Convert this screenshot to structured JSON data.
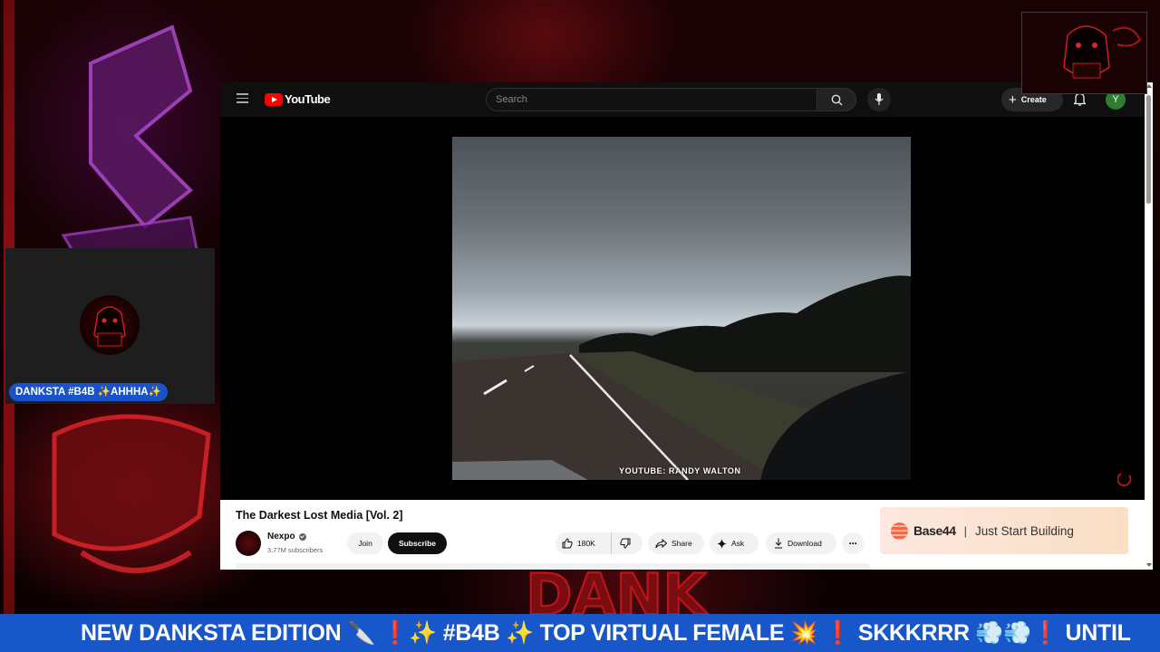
{
  "youtube": {
    "logo_text": "YouTube",
    "search_placeholder": "Search",
    "create_label": "Create",
    "avatar_letter": "Y"
  },
  "video": {
    "watermark": "YOUTUBE: RANDY WALTON",
    "title": "The Darkest Lost Media [Vol. 2]"
  },
  "channel": {
    "name": "Nexpo",
    "subscribers": "3.77M subscribers",
    "join_label": "Join",
    "subscribe_label": "Subscribe"
  },
  "actions": {
    "likes": "180K",
    "share_label": "Share",
    "ask_label": "Ask",
    "download_label": "Download",
    "more_label": "···"
  },
  "ad": {
    "brand": "Base44",
    "separator": "|",
    "tagline": "Just Start Building"
  },
  "stream": {
    "cam_name": "DANKSTA #B4B ✨AHHHA✨",
    "ticker": "NEW DANKSTA EDITION 🔪 ❗✨ #B4B ✨ TOP VIRTUAL FEMALE 💥 ❗ SKKKRRR 💨💨❗ UNTIL",
    "graffiti_text": "DANK"
  },
  "colors": {
    "ticker_bg": "#1757c9",
    "cam_badge_bg": "#1a52c9",
    "youtube_red": "#ff0000",
    "stream_red": "#c4141a"
  }
}
